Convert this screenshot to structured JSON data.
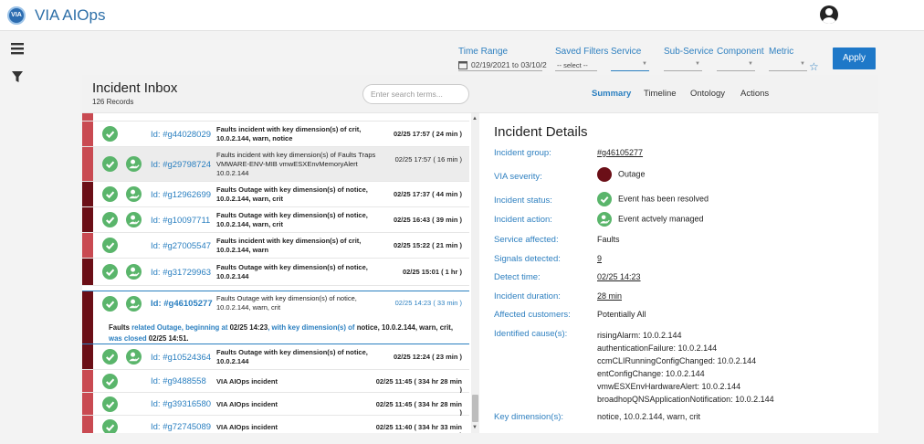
{
  "app": {
    "logo_text": "VIA",
    "title": "VIA AIOps"
  },
  "filters": {
    "time_range_label": "Time Range",
    "time_range_value": "02/19/2021 to 03/10/2",
    "saved_filters_label": "Saved Filters",
    "saved_filters_value": "-- select --",
    "service_label": "Service",
    "sub_service_label": "Sub-Service",
    "component_label": "Component",
    "metric_label": "Metric",
    "apply_label": "Apply"
  },
  "inbox": {
    "title": "Incident Inbox",
    "count": "126 Records",
    "search_placeholder": "Enter search terms...",
    "tabs": [
      "Summary",
      "Timeline",
      "Ontology",
      "Actions"
    ],
    "rows": [
      {
        "id": "Id: #g44028029",
        "desc": "Faults incident with key dimension(s) of crit, 10.0.2.144, warn, notice",
        "time": "02/25 17:57 ( 24 min )"
      },
      {
        "id": "Id: #g29798724",
        "desc": "Faults incident with key dimension(s) of Faults Traps VMWARE-ENV-MIB vmwESXEnvMemoryAlert 10.0.2.144",
        "time": "02/25 17:57 ( 16 min )"
      },
      {
        "id": "Id: #g12962699",
        "desc": "Faults Outage with key dimension(s) of notice, 10.0.2.144, warn, crit",
        "time": "02/25 17:37 ( 44 min )"
      },
      {
        "id": "Id: #g10097711",
        "desc": "Faults Outage with key dimension(s) of notice, 10.0.2.144, warn, crit",
        "time": "02/25 16:43 ( 39 min )"
      },
      {
        "id": "Id: #g27005547",
        "desc": "Faults incident with key dimension(s) of crit, 10.0.2.144, warn",
        "time": "02/25 15:22 ( 21 min )"
      },
      {
        "id": "Id: #g31729963",
        "desc": "Faults Outage with key dimension(s) of notice, 10.0.2.144",
        "time": "02/25 15:01 ( 1 hr )"
      },
      {
        "id": "Id: #g46105277",
        "desc": "Faults Outage with key dimension(s) of notice, 10.0.2.144, warn, crit",
        "time": "02/25 14:23 ( 33 min )"
      },
      {
        "id": "Id: #g10524364",
        "desc": "Faults Outage with key dimension(s) of notice, 10.0.2.144",
        "time": "02/25 12:24 ( 23 min )"
      },
      {
        "id": "Id: #g9488558",
        "desc": "VIA AIOps incident",
        "time": "02/25 11:45 ( 334 hr 28 min )"
      },
      {
        "id": "Id: #g39316580",
        "desc": "VIA AIOps incident",
        "time": "02/25 11:45 ( 334 hr 28 min )"
      },
      {
        "id": "Id: #g72745089",
        "desc": "VIA AIOps incident",
        "time": "02/25 11:40 ( 334 hr 33 min )"
      }
    ],
    "expanded": {
      "p1": "Faults ",
      "p2": "related Outage, beginning at ",
      "p3": "02/25 14:23",
      "p4": ", with key dimension(s) of ",
      "p5": "notice, 10.0.2.144, warn, crit,",
      "p6": "was closed ",
      "p7": "02/25 14:51."
    }
  },
  "details": {
    "title": "Incident Details",
    "group_label": "Incident group:",
    "group_value": "#g46105277",
    "severity_label": "VIA severity:",
    "severity_value": "Outage",
    "status_label": "Incident status:",
    "status_value": "Event has been resolved",
    "action_label": "Incident action:",
    "action_value": "Event actvely managed",
    "service_label": "Service affected:",
    "service_value": "Faults",
    "signals_label": "Signals detected:",
    "signals_value": "9",
    "detect_label": "Detect time:",
    "detect_value": "02/25 14:23",
    "duration_label": "Incident duration:",
    "duration_value": "28 min",
    "customers_label": "Affected customers:",
    "customers_value": "Potentially All",
    "causes_label": "Identified cause(s):",
    "causes": [
      "risingAlarm: 10.0.2.144",
      "authenticationFailure: 10.0.2.144",
      "ccmCLIRunningConfigChanged: 10.0.2.144",
      "entConfigChange: 10.0.2.144",
      "vmwESXEnvHardwareAlert: 10.0.2.144",
      "broadhopQNSApplicationNotification: 10.0.2.144"
    ],
    "keydim_label": "Key dimension(s):",
    "keydim_value": "notice, 10.0.2.144, warn, crit"
  },
  "colors": {
    "accent": "#2a7fc0",
    "apply": "#1e78c8",
    "sev_red": "#c94a52",
    "sev_dark": "#6b0f17",
    "ok_green": "#5ab56b"
  }
}
